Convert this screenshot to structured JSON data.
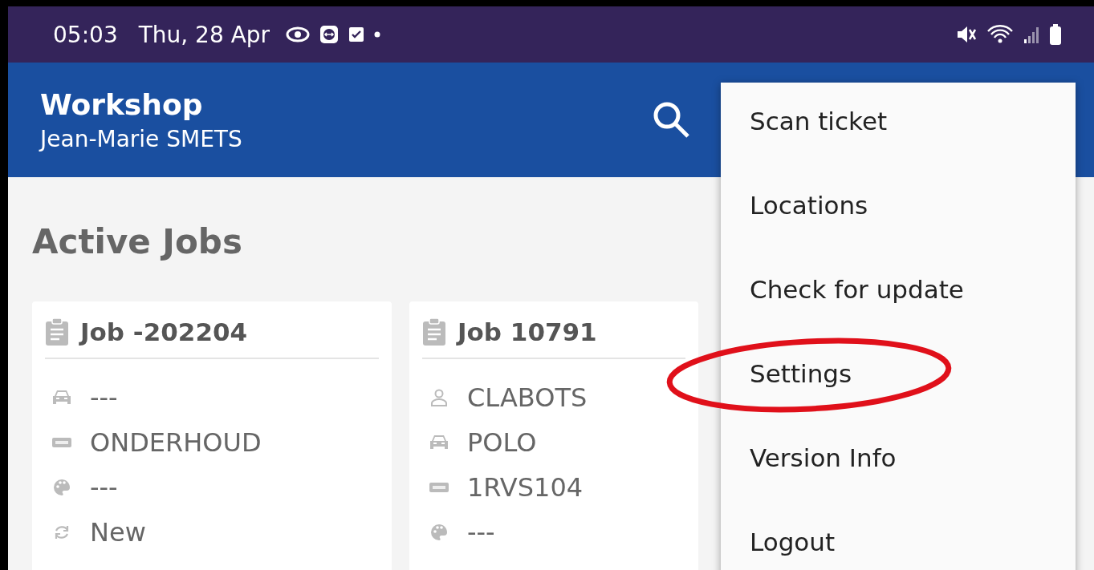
{
  "status_bar": {
    "time": "05:03",
    "date": "Thu, 28 Apr"
  },
  "app_bar": {
    "title": "Workshop",
    "subtitle": "Jean-Marie SMETS"
  },
  "page_title": "Active Jobs",
  "jobs": [
    {
      "title": "Job -202204",
      "fields": [
        {
          "kind": "car",
          "text": "---"
        },
        {
          "kind": "plate",
          "text": "ONDERHOUD"
        },
        {
          "kind": "color",
          "text": "---"
        },
        {
          "kind": "status",
          "text": "New"
        }
      ]
    },
    {
      "title": "Job 10791",
      "fields": [
        {
          "kind": "customer",
          "text": "CLABOTS"
        },
        {
          "kind": "car",
          "text": "POLO"
        },
        {
          "kind": "plate",
          "text": "1RVS104"
        },
        {
          "kind": "color",
          "text": "---"
        }
      ]
    }
  ],
  "menu": [
    {
      "label": "Scan ticket",
      "highlighted": false
    },
    {
      "label": "Locations",
      "highlighted": false
    },
    {
      "label": "Check for update",
      "highlighted": false
    },
    {
      "label": "Settings",
      "highlighted": true
    },
    {
      "label": "Version Info",
      "highlighted": false
    },
    {
      "label": "Logout",
      "highlighted": false
    }
  ]
}
